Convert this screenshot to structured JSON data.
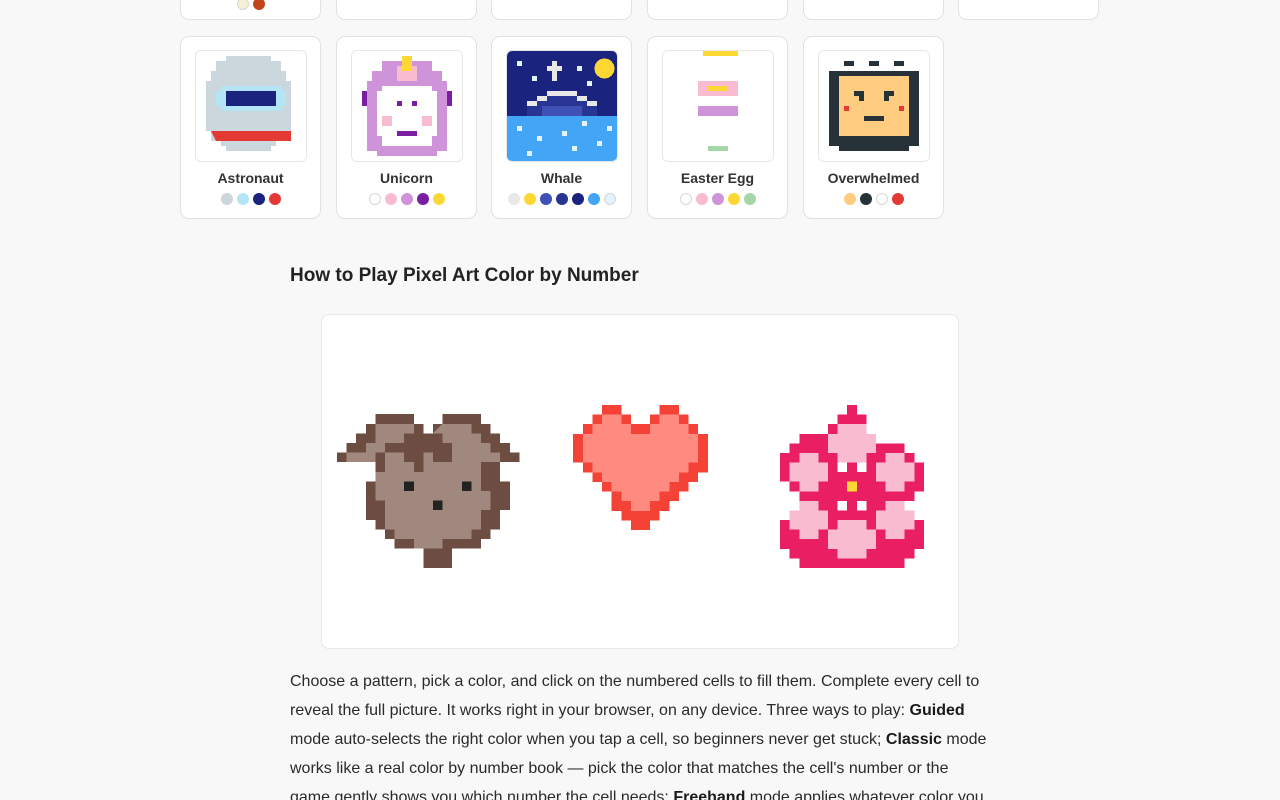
{
  "cards_top": [
    {
      "swatches": [
        "#f5efd5",
        "#c1441d"
      ]
    },
    {
      "swatches": []
    },
    {
      "swatches": []
    },
    {
      "swatches": []
    },
    {
      "swatches": []
    },
    {
      "swatches": []
    }
  ],
  "cards": [
    {
      "name": "Astronaut",
      "swatches": [
        "#ccd6dd",
        "#b3e5f7",
        "#1a237e",
        "#e53935"
      ]
    },
    {
      "name": "Unicorn",
      "swatches": [
        "#ffffff",
        "#f8bbd0",
        "#ce93d8",
        "#7b1fa2",
        "#fdd835"
      ]
    },
    {
      "name": "Whale",
      "swatches": [
        "#e8e8e8",
        "#fdd835",
        "#3f51b5",
        "#283593",
        "#1a237e",
        "#42a5f5",
        "#e3f2fd"
      ]
    },
    {
      "name": "Easter Egg",
      "swatches": [
        "#ffffff",
        "#f8bbd0",
        "#ce93d8",
        "#fdd835",
        "#a5d6a7"
      ]
    },
    {
      "name": "Overwhelmed",
      "swatches": [
        "#ffcc80",
        "#263238",
        "#ffffff",
        "#e53935"
      ]
    }
  ],
  "howto": {
    "title": "How to Play Pixel Art Color by Number",
    "p_1": "Choose a pattern, pick a color, and click on the numbered cells to fill them. Complete every cell to reveal the full picture. It works right in your browser, on any device. Three ways to play: ",
    "mode_guided": "Guided",
    "p_2": " mode auto-selects the right color when you tap a cell, so beginners never get stuck; ",
    "mode_classic": "Classic",
    "p_3": " mode works like a real color by number book — pick the color that matches the cell's number or the game gently shows you which number the cell needs; ",
    "mode_freehand": "Freehand",
    "p_4": " mode applies whatever color you"
  },
  "icons": {
    "demo_1": "squirrel-pixel-icon",
    "demo_2": "heart-pixel-icon",
    "demo_3": "flower-pixel-icon"
  }
}
